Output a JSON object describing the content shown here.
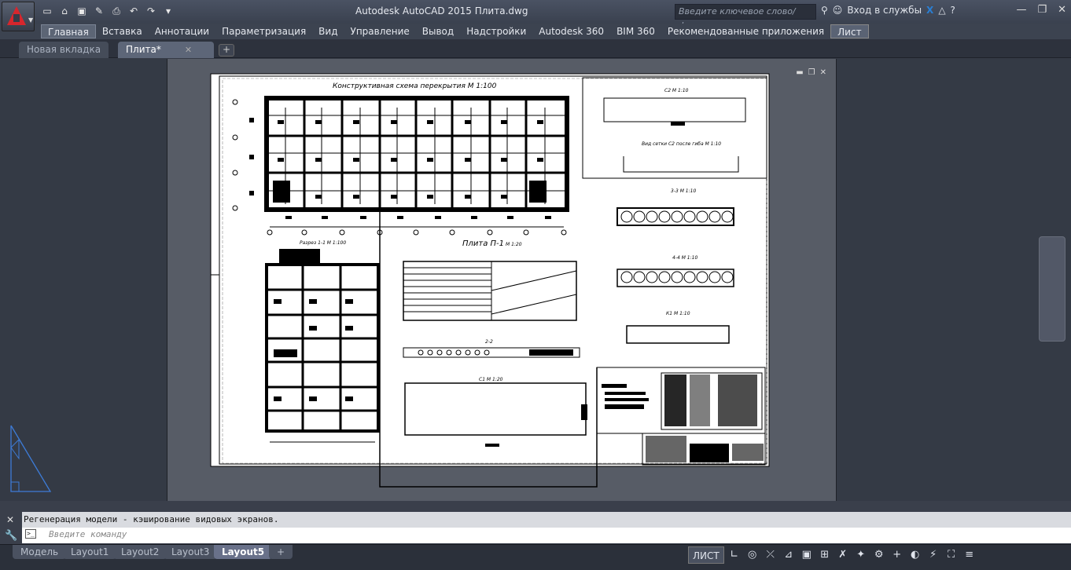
{
  "app": {
    "title": "Autodesk AutoCAD 2015   Плита.dwg"
  },
  "qat": {
    "items": [
      "new-icon",
      "open-icon",
      "save-icon",
      "saveas-icon",
      "print-icon",
      "undo-icon",
      "redo-icon",
      "more-icon"
    ]
  },
  "search": {
    "placeholder": "Введите ключевое слово/фразу"
  },
  "signin": {
    "label": "Вход в службы"
  },
  "menu": {
    "items": [
      "Главная",
      "Вставка",
      "Аннотации",
      "Параметризация",
      "Вид",
      "Управление",
      "Вывод",
      "Надстройки",
      "Autodesk 360",
      "BIM 360",
      "Рекомендованные приложения",
      "Лист"
    ]
  },
  "tabs": {
    "new": "Новая вкладка",
    "file": "Плита*"
  },
  "drawing": {
    "title1": "Конструктивная схема перекрытия М 1:100",
    "title2": "Плита П-1",
    "title2_scale": "М 1:20",
    "razrez": "Разрез 1-1 М 1:100",
    "c2": "С2 М 1:10",
    "vid": "Вид сетки С2 после гиба М 1:10",
    "s33": "3-3 М 1:10",
    "s44": "4-4 М 1:10",
    "k1": "К1 М 1:10",
    "c1": "С1 М 1:20",
    "s22": "2-2"
  },
  "command": {
    "history": "Регенерация модели - кэширование видовых экранов.",
    "placeholder": "Введите команду"
  },
  "layouts": {
    "items": [
      "Модель",
      "Layout1",
      "Layout2",
      "Layout3",
      "Layout5"
    ],
    "active": "Layout5"
  },
  "status": {
    "space": "ЛИСТ"
  }
}
